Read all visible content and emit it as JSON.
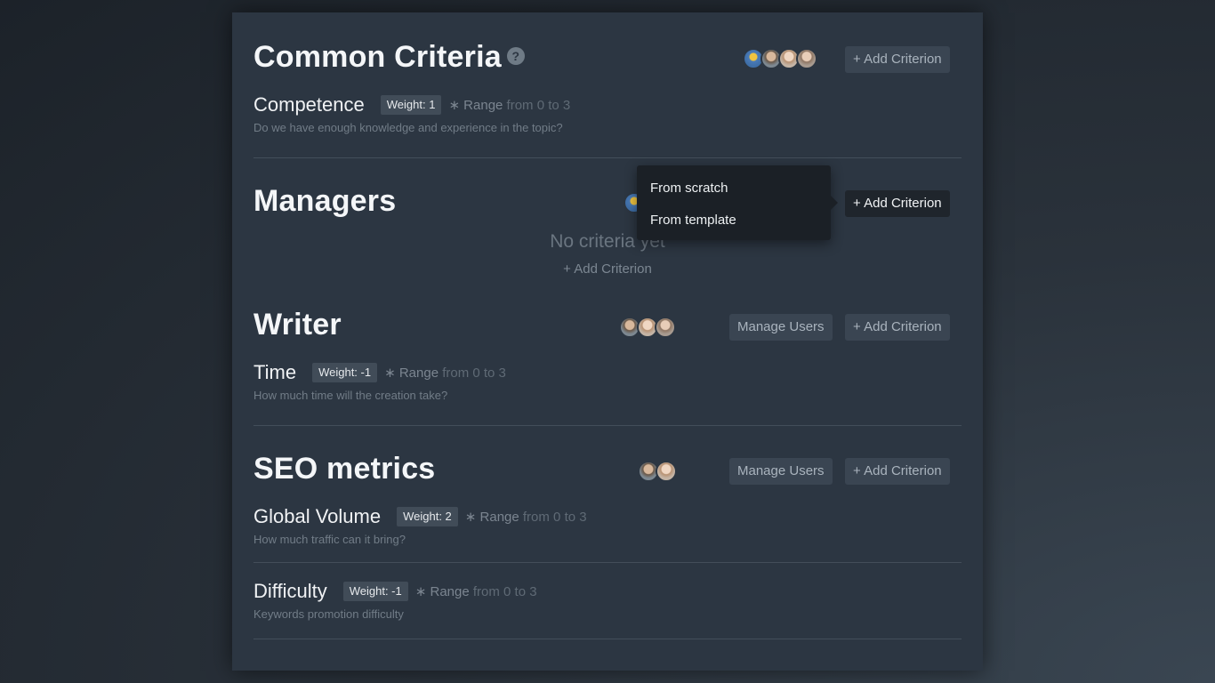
{
  "sections": {
    "common": {
      "title": "Common Criteria",
      "help_icon": "?",
      "add_label": "+ Add Criterion",
      "criteria": [
        {
          "name": "Competence",
          "weight": "Weight: 1",
          "range_prefix": "∗ Range",
          "range_value": "from 0 to 3",
          "description": "Do we have enough knowledge and experience in the topic?"
        }
      ]
    },
    "managers": {
      "title": "Managers",
      "add_label": "+ Add Criterion",
      "empty_title": "No criteria yet",
      "empty_link": "+ Add Criterion"
    },
    "writer": {
      "title": "Writer",
      "manage_label": "Manage Users",
      "add_label": "+ Add Criterion",
      "criteria": [
        {
          "name": "Time",
          "weight": "Weight: -1",
          "range_prefix": "∗ Range",
          "range_value": "from 0 to 3",
          "description": "How much time will the creation take?"
        }
      ]
    },
    "seo": {
      "title": "SEO metrics",
      "manage_label": "Manage Users",
      "add_label": "+ Add Criterion",
      "criteria": [
        {
          "name": "Global Volume",
          "weight": "Weight: 2",
          "range_prefix": "∗ Range",
          "range_value": "from 0 to 3",
          "description": "How much traffic can it bring?"
        },
        {
          "name": "Difficulty",
          "weight": "Weight: -1",
          "range_prefix": "∗ Range",
          "range_value": "from 0 to 3",
          "description": "Keywords promotion difficulty"
        }
      ]
    }
  },
  "dropdown": {
    "items": [
      "From scratch",
      "From template"
    ]
  },
  "colors": {
    "panel": "#2c3642",
    "button": "#3a4552",
    "active_button": "#1f252c",
    "dropdown": "#1b2026"
  },
  "icons": [
    "help-icon",
    "avatar"
  ]
}
